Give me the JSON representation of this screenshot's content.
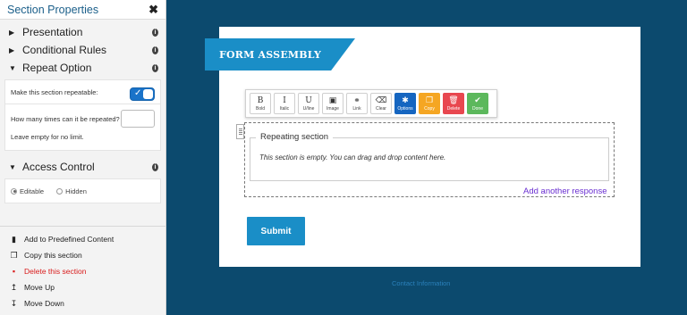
{
  "sidebar": {
    "title": "Section Properties",
    "close_icon": "close-icon",
    "sections": [
      {
        "label": "Presentation",
        "expanded": false
      },
      {
        "label": "Conditional Rules",
        "expanded": false
      },
      {
        "label": "Repeat Option",
        "expanded": true
      },
      {
        "label": "Access Control",
        "expanded": true
      }
    ],
    "repeat": {
      "toggle_label": "Make this section repeatable:",
      "toggle_on": true,
      "count_label": "How many times can it be repeated?",
      "count_value": "",
      "hint": "Leave empty for no limit."
    },
    "access": {
      "options": [
        "Editable",
        "Hidden"
      ],
      "selected": "Editable"
    },
    "actions": [
      {
        "label": "Add to Predefined Content",
        "icon": "bookmark-icon"
      },
      {
        "label": "Copy this section",
        "icon": "copy-icon"
      },
      {
        "label": "Delete this section",
        "icon": "trash-icon"
      },
      {
        "label": "Move Up",
        "icon": "arrow-up-icon"
      },
      {
        "label": "Move Down",
        "icon": "arrow-down-icon"
      }
    ]
  },
  "form": {
    "banner": "FORM ASSEMBLY",
    "toolbar": [
      {
        "label": "Bold",
        "glyph": "B"
      },
      {
        "label": "Italic",
        "glyph": "I"
      },
      {
        "label": "U/line",
        "glyph": "U"
      },
      {
        "label": "Image",
        "glyph": "▣"
      },
      {
        "label": "Link",
        "glyph": "⚭"
      },
      {
        "label": "Clear",
        "glyph": "⌫"
      },
      {
        "label": "Options",
        "glyph": "✱",
        "color": "#1565c0"
      },
      {
        "label": "Copy",
        "glyph": "❐",
        "color": "#f5a623"
      },
      {
        "label": "Delete",
        "glyph": "🗑",
        "color": "#e8474f"
      },
      {
        "label": "Done",
        "glyph": "✔",
        "color": "#5cb85c"
      }
    ],
    "section_legend": "Repeating section",
    "empty_message": "This section is empty. You can drag and drop content here.",
    "add_another": "Add another response",
    "submit": "Submit",
    "footer_link": "Contact Information"
  },
  "colors": {
    "background": "#0c4a6e",
    "accent": "#1a8ec7",
    "toggle": "#1a73c9",
    "link_purple": "#6a2fd1",
    "danger": "#d91c1c"
  }
}
